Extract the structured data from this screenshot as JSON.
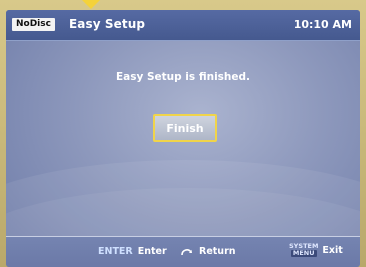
{
  "topbar": {
    "disc_status": "NoDisc",
    "title": "Easy Setup",
    "clock": "10:10 AM"
  },
  "main": {
    "message": "Easy Setup is finished.",
    "finish_label": "Finish"
  },
  "bottombar": {
    "enter_key": "ENTER",
    "enter_label": "Enter",
    "return_icon": "return-arrow-icon",
    "return_label": "Return",
    "system_key_top": "SYSTEM",
    "system_key_bottom": "MENU",
    "exit_label": "Exit"
  },
  "colors": {
    "focus_highlight": "#f0d44a",
    "topbar": "#4c5f97",
    "background": "#8d98bc"
  }
}
